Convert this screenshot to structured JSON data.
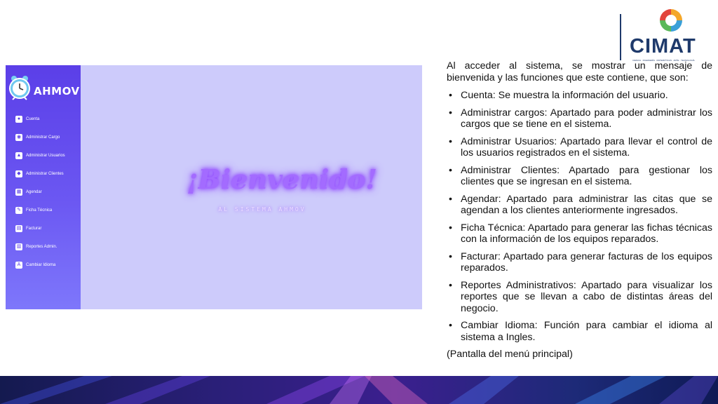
{
  "logo": {
    "name": "CIMAT",
    "tagline": "CIENCIA · INGENIERÍA · MATEMÁTICAS · ARTE · TECNOLOGÍA"
  },
  "app": {
    "brand": "AHMOV",
    "menu": [
      {
        "label": "Cuenta",
        "icon": "user-icon"
      },
      {
        "label": "Administrar Cargo",
        "icon": "briefcase-icon"
      },
      {
        "label": "Administrar Usuarios",
        "icon": "users-icon"
      },
      {
        "label": "Administrar Clientes",
        "icon": "clients-icon"
      },
      {
        "label": "Agendar",
        "icon": "calendar-icon"
      },
      {
        "label": "Ficha Técnica",
        "icon": "wrench-icon"
      },
      {
        "label": "Facturar",
        "icon": "invoice-icon"
      },
      {
        "label": "Reportes Admin.",
        "icon": "report-icon"
      },
      {
        "label": "Cambiar Idioma",
        "icon": "language-icon"
      }
    ],
    "welcome_title": "¡Bienvenido!",
    "welcome_subtitle": "AL SISTEMA AHMOV",
    "colors": {
      "sidebar": "#5b3fe8",
      "background": "#cdcbfb",
      "glow": "#a36bff"
    }
  },
  "doc": {
    "intro": "Al acceder al sistema, se mostrar un mensaje de bienvenida y las funciones que este contiene, que son:",
    "items": [
      "Cuenta: Se muestra la información del usuario.",
      "Administrar cargos: Apartado para poder administrar los cargos que se tiene en el sistema.",
      "Administrar Usuarios: Apartado para llevar el control de los usuarios registrados en el sistema.",
      "Administrar Clientes: Apartado para gestionar los clientes que se ingresan en el sistema.",
      "Agendar: Apartado para administrar las citas que se agendan a los clientes anteriormente ingresados.",
      "Ficha Técnica: Apartado para generar las fichas técnicas con la información de los equipos reparados.",
      "Facturar: Apartado para generar facturas de los equipos reparados.",
      "Reportes Administrativos: Apartado para visualizar los reportes que se llevan a cabo de distintas áreas del negocio.",
      "Cambiar Idioma: Función para cambiar el idioma al sistema a Ingles."
    ],
    "caption": "(Pantalla del menú principal)"
  }
}
